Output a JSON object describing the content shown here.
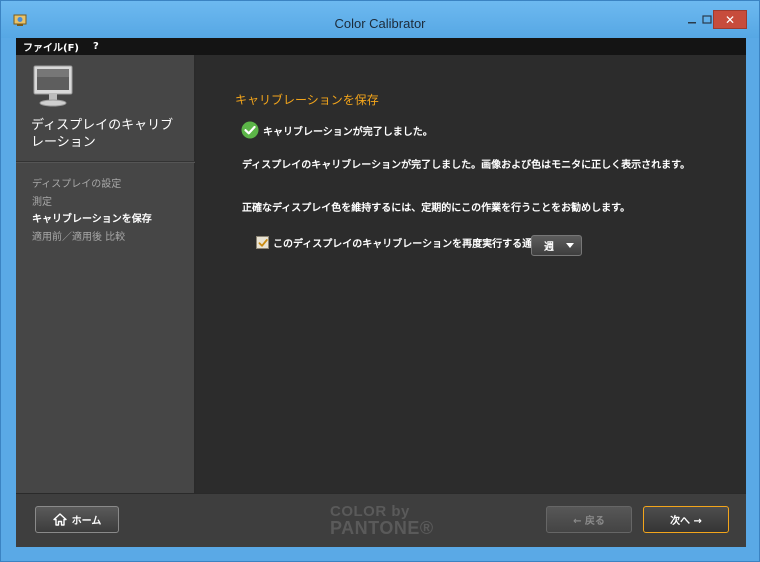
{
  "window": {
    "title": "Color Calibrator",
    "close_label": "✕"
  },
  "menu": {
    "items": [
      "ファイル(F)",
      "?"
    ]
  },
  "sidebar": {
    "heading": "ディスプレイのキャリブレーション",
    "steps": [
      {
        "label": "ディスプレイの設定",
        "active": false
      },
      {
        "label": "測定",
        "active": false
      },
      {
        "label": "キャリブレーションを保存",
        "active": true
      },
      {
        "label": "適用前／適用後 比較",
        "active": false
      }
    ]
  },
  "main": {
    "section_title": "キャリブレーションを保存",
    "status_text": "キャリブレーションが完了しました。",
    "paragraph1": "ディスプレイのキャリブレーションが完了しました。画像および色はモニタに正しく表示されます。",
    "paragraph2": "正確なディスプレイ色を維持するには、定期的にこの作業を行うことをお勧めします。",
    "notify": {
      "checked": true,
      "label": "このディスプレイのキャリブレーションを再度実行する通知:",
      "selected_value": "週"
    }
  },
  "footer": {
    "home_label": "ホーム",
    "back_label": "← 戻る",
    "next_label": "次へ →",
    "brand_line1": "COLOR by",
    "brand_line2": "PANTONE®"
  },
  "colors": {
    "accent": "#f3a51b",
    "success": "#5cb548",
    "titlebar": "#5aa9e6"
  }
}
